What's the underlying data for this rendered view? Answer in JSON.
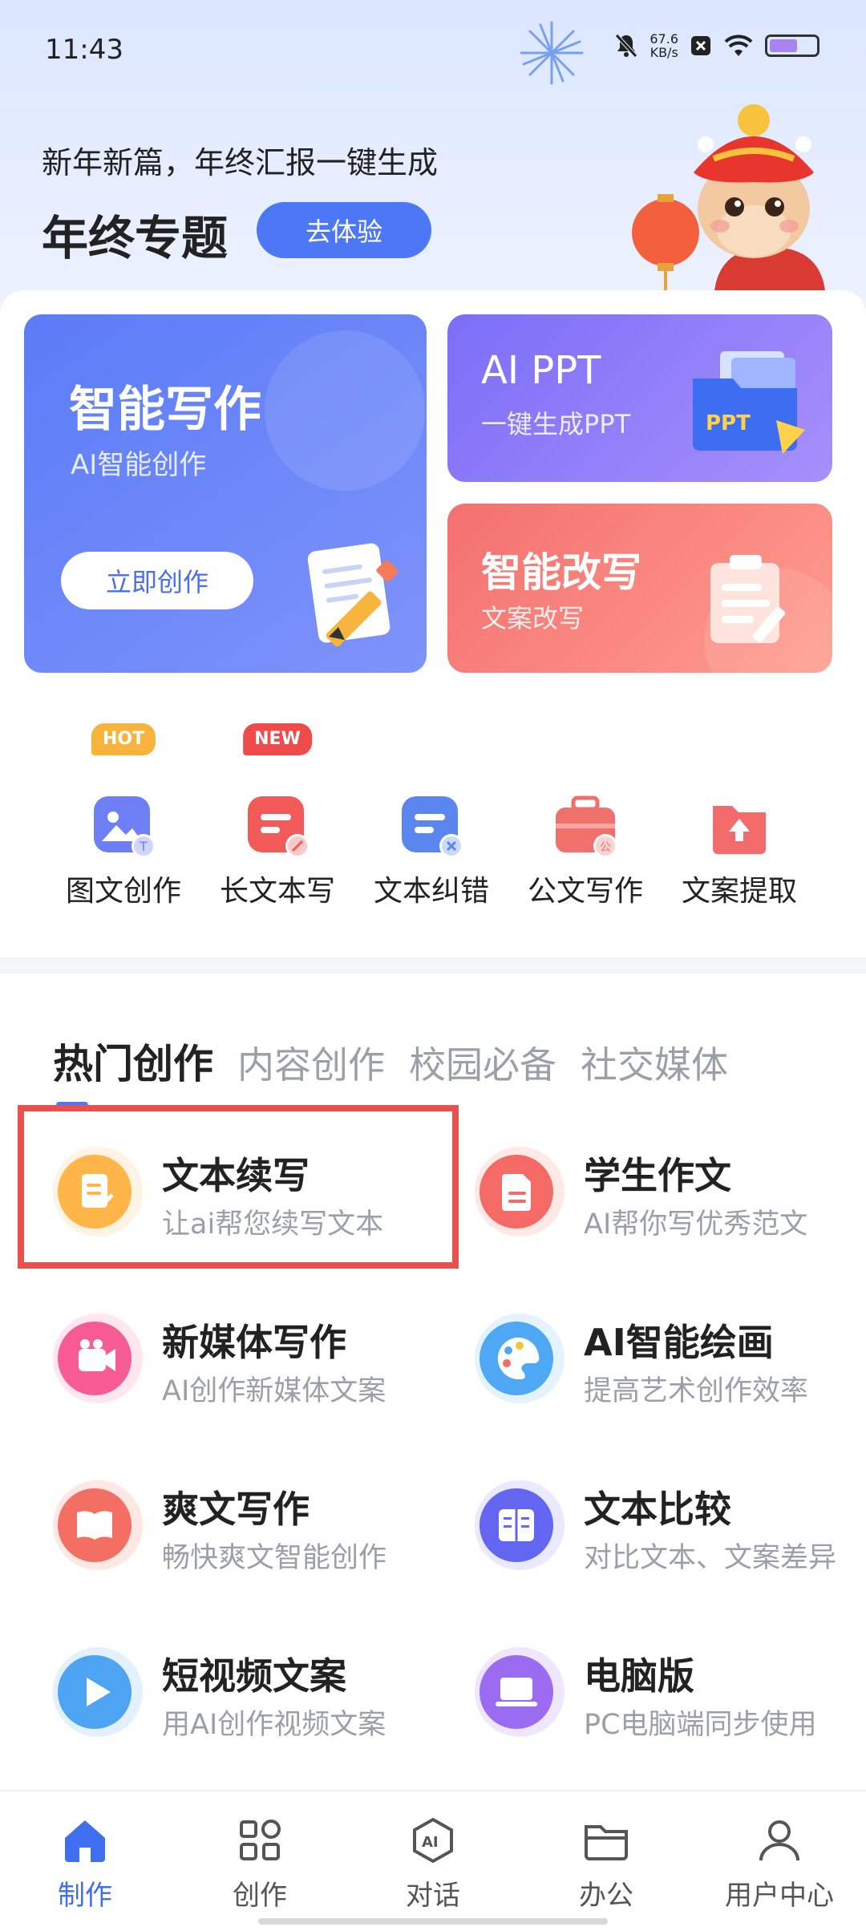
{
  "status_bar": {
    "time": "11:43",
    "net_speed_value": "67.6",
    "net_speed_unit": "KB/s",
    "battery_percent": 60,
    "icons": [
      "bell-off-icon",
      "sim-x-icon",
      "wifi-icon",
      "battery-icon"
    ]
  },
  "hero": {
    "subtitle": "新年新篇，年终汇报一键生成",
    "title": "年终专题",
    "cta_label": "去体验"
  },
  "cards": {
    "write": {
      "title": "智能写作",
      "subtitle": "AI智能创作",
      "button": "立即创作"
    },
    "ppt": {
      "title": "AI PPT",
      "subtitle": "一键生成PPT",
      "icon_text": "PPT"
    },
    "rewrite": {
      "title": "智能改写",
      "subtitle": "文案改写"
    }
  },
  "tools": [
    {
      "label": "图文创作",
      "badge": "HOT",
      "icon": "image-text-icon"
    },
    {
      "label": "长文本写",
      "badge": "NEW",
      "icon": "long-text-icon"
    },
    {
      "label": "文本纠错",
      "badge": "",
      "icon": "text-correct-icon"
    },
    {
      "label": "公文写作",
      "badge": "",
      "icon": "briefcase-icon"
    },
    {
      "label": "文案提取",
      "badge": "",
      "icon": "folder-upload-icon"
    }
  ],
  "tabs": [
    "热门创作",
    "内容创作",
    "校园必备",
    "社交媒体"
  ],
  "features": [
    {
      "name": "文本续写",
      "desc": "让ai帮您续写文本",
      "icon": "document-edit-icon"
    },
    {
      "name": "学生作文",
      "desc": "AI帮你写优秀范文",
      "icon": "document-icon"
    },
    {
      "name": "新媒体写作",
      "desc": "AI创作新媒体文案",
      "icon": "video-camera-icon"
    },
    {
      "name": "AI智能绘画",
      "desc": "提高艺术创作效率",
      "icon": "palette-icon"
    },
    {
      "name": "爽文写作",
      "desc": "畅快爽文智能创作",
      "icon": "open-book-icon"
    },
    {
      "name": "文本比较",
      "desc": "对比文本、文案差异",
      "icon": "compare-book-icon"
    },
    {
      "name": "短视频文案",
      "desc": "用AI创作视频文案",
      "icon": "play-icon"
    },
    {
      "name": "电脑版",
      "desc": "PC电脑端同步使用",
      "icon": "laptop-icon"
    }
  ],
  "bottom_nav": [
    {
      "label": "制作",
      "icon": "home-icon",
      "active": true
    },
    {
      "label": "创作",
      "icon": "grid-icon",
      "active": false
    },
    {
      "label": "对话",
      "icon": "ai-chat-icon",
      "active": false
    },
    {
      "label": "办公",
      "icon": "folder-icon",
      "active": false
    },
    {
      "label": "用户中心",
      "icon": "user-icon",
      "active": false
    }
  ],
  "colors": {
    "accent": "#4c78f6",
    "hot_badge": "#f8b33c",
    "new_badge": "#ef4b4b",
    "highlight": "#e8514d"
  }
}
